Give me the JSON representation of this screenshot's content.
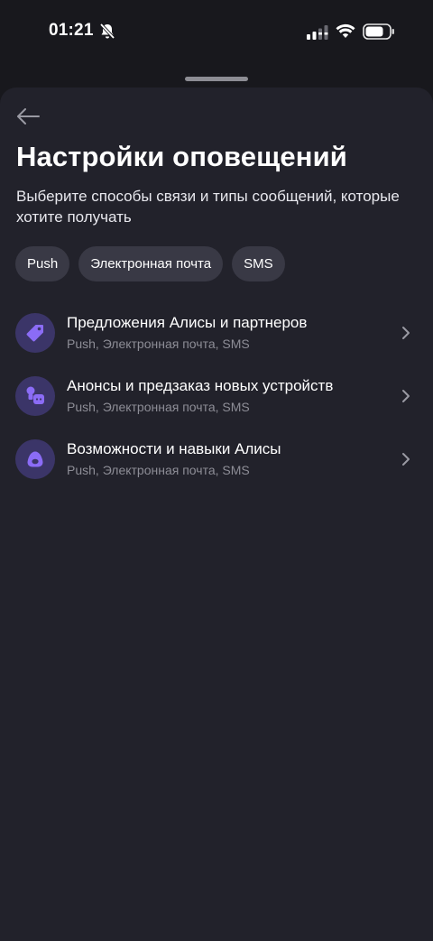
{
  "status_bar": {
    "time": "01:21"
  },
  "header": {
    "title": "Настройки оповещений",
    "subtitle": "Выберите способы связи и типы сообщений, которые хотите получать"
  },
  "channels": [
    {
      "label": "Push"
    },
    {
      "label": "Электронная почта"
    },
    {
      "label": "SMS"
    }
  ],
  "categories": [
    {
      "title": "Предложения Алисы и партнеров",
      "channels": "Push, Электронная почта, SMS",
      "icon": "tag-icon"
    },
    {
      "title": "Анонсы и предзаказ новых устройств",
      "channels": "Push, Электронная почта, SMS",
      "icon": "devices-icon"
    },
    {
      "title": "Возможности и навыки Алисы",
      "channels": "Push, Электронная почта, SMS",
      "icon": "alice-icon"
    }
  ],
  "colors": {
    "background": "#18181d",
    "sheet": "#22222b",
    "chip": "#393945",
    "icon_circle": "#3b3568",
    "icon_accent": "#8b6cf6",
    "muted_text": "#8d8d96"
  }
}
